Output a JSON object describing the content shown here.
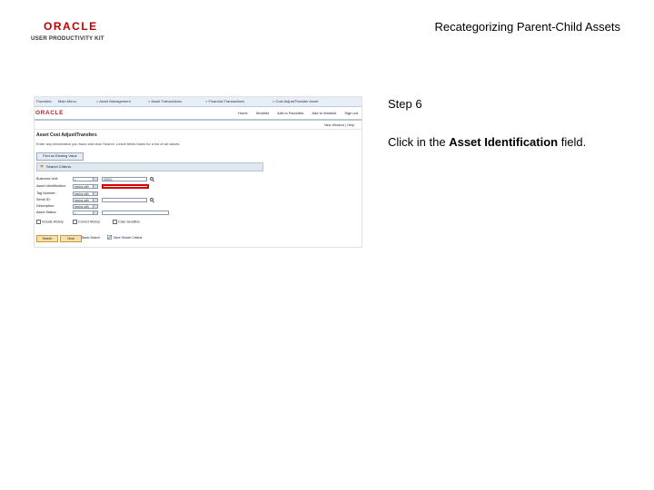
{
  "logo": {
    "brand": "ORACLE",
    "tagline": "USER PRODUCTIVITY KIT"
  },
  "slide_title": "Recategorizing Parent-Child Assets",
  "screenshot": {
    "topbar": [
      "Favorites",
      "Main Menu",
      "> Asset Management",
      "> Asset Transactions",
      "> Financial Transactions",
      "> Cost Adjust/Transfer Asset"
    ],
    "brand": "ORACLE",
    "nav_links": [
      "Home",
      "Worklist",
      "Add to Favorites",
      "Add to Worklist",
      "Sign out"
    ],
    "links_right": "New Window | Help",
    "page_heading": "Asset Cost Adjust/Transfers",
    "page_description": "Enter any information you have and click Search. Leave fields blank for a list of all values.",
    "find_tab": "Find an Existing Value",
    "section_title": "Search Criteria",
    "fields": [
      {
        "label": "Business Unit:",
        "op": "=",
        "value": "US001"
      },
      {
        "label": "Asset Identification:",
        "op": "begins with",
        "value": ""
      },
      {
        "label": "Tag Number:",
        "op": "begins with",
        "value": ""
      },
      {
        "label": "Serial ID:",
        "op": "begins with",
        "value": ""
      },
      {
        "label": "Description:",
        "op": "begins with",
        "value": ""
      },
      {
        "label": "Asset Status:",
        "op": "=",
        "value": ""
      }
    ],
    "checkboxes": [
      "Include History",
      "Correct History",
      "Case Sensitive"
    ],
    "buttons": {
      "search": "Search",
      "clear": "Clear"
    },
    "links": {
      "basic_search": "Basic Search",
      "save_search": "Save Search Criteria"
    }
  },
  "step_label": "Step 6",
  "instruction": {
    "prefix": "Click in the ",
    "bold": "Asset Identification",
    "suffix": " field."
  },
  "colors": {
    "highlight": "#d40000",
    "brand": "#c00000"
  }
}
